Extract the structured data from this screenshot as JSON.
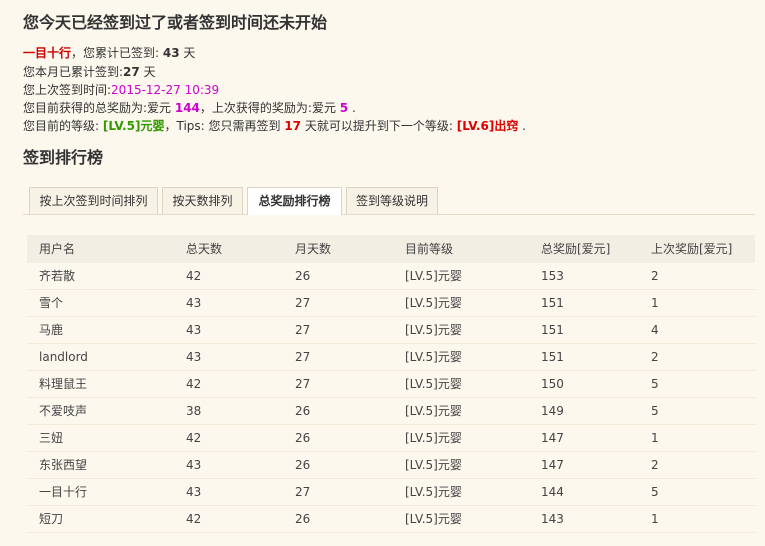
{
  "header": {
    "title": "您今天已经签到过了或者签到时间还未开始"
  },
  "info": {
    "line1": {
      "name": "一目十行",
      "text1": "，您累计已签到: ",
      "total_days": "43",
      "unit": " 天"
    },
    "line2": {
      "text1": "您本月已累计签到:",
      "month_days": "27",
      "unit": " 天"
    },
    "line3": {
      "text1": "您上次签到时间:",
      "last_time": "2015-12-27 10:39"
    },
    "line4": {
      "text1": "您目前获得的总奖励为:爱元 ",
      "total_reward": "144",
      "text2": "，上次获得的奖励为:爱元 ",
      "last_reward": "5",
      "text3": " ."
    },
    "line5": {
      "text1": "您目前的等级: ",
      "level": "[LV.5]元婴",
      "text2": "，Tips: 您只需再签到 ",
      "need_days": "17",
      "text3": " 天就可以提升到下一个等级: ",
      "next_level": "[LV.6]出窍",
      "text4": " ."
    }
  },
  "ranking": {
    "title": "签到排行榜",
    "tabs": [
      "按上次签到时间排列",
      "按天数排列",
      "总奖励排行榜",
      "签到等级说明"
    ],
    "active_tab": 2,
    "columns": [
      "用户名",
      "总天数",
      "月天数",
      "目前等级",
      "总奖励[爱元]",
      "上次奖励[爱元]"
    ],
    "rows": [
      [
        "齐若散",
        "42",
        "26",
        "[LV.5]元婴",
        "153",
        "2"
      ],
      [
        "雪个",
        "43",
        "27",
        "[LV.5]元婴",
        "151",
        "1"
      ],
      [
        "马鹿",
        "43",
        "27",
        "[LV.5]元婴",
        "151",
        "4"
      ],
      [
        "landlord",
        "43",
        "27",
        "[LV.5]元婴",
        "151",
        "2"
      ],
      [
        "料理鼠王",
        "42",
        "27",
        "[LV.5]元婴",
        "150",
        "5"
      ],
      [
        "不爱吱声",
        "38",
        "26",
        "[LV.5]元婴",
        "149",
        "5"
      ],
      [
        "三妞",
        "42",
        "26",
        "[LV.5]元婴",
        "147",
        "1"
      ],
      [
        "东张西望",
        "43",
        "26",
        "[LV.5]元婴",
        "147",
        "2"
      ],
      [
        "一目十行",
        "43",
        "27",
        "[LV.5]元婴",
        "144",
        "5"
      ],
      [
        "短刀",
        "42",
        "26",
        "[LV.5]元婴",
        "143",
        "1"
      ]
    ]
  }
}
